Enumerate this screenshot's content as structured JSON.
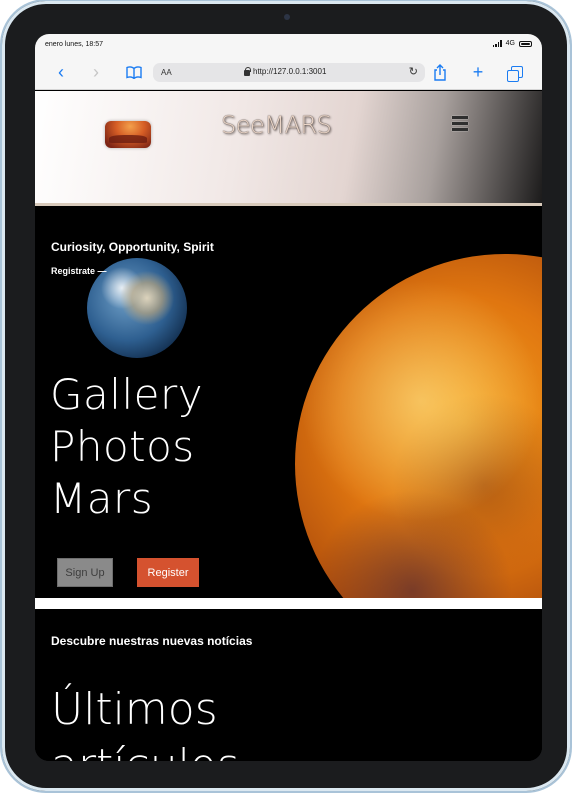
{
  "status": {
    "time": "enero lunes, 18:57",
    "network": "4G"
  },
  "browser": {
    "text_size_label": "AA",
    "url": "http://127.0.0.1:3001"
  },
  "site": {
    "brand": "SeeMARS"
  },
  "hero": {
    "tagline": "Curiosity, Opportunity, Spirit",
    "registrate": "Registrate —",
    "title_line1": "Gallery",
    "title_line2": "Photos",
    "title_line3": "Mars",
    "signup_label": "Sign Up",
    "register_label": "Register"
  },
  "news": {
    "eyebrow": "Descubre nuestras nuevas notícias",
    "title_line1": "Últimos",
    "title_line2": "artículos"
  },
  "colors": {
    "register_button": "#d5522f",
    "signup_button": "#8a8a8a",
    "safari_accent": "#1b7cf2"
  },
  "icons": [
    "back-icon",
    "forward-icon",
    "bookmarks-icon",
    "lock-icon",
    "reload-icon",
    "share-icon",
    "new-tab-icon",
    "tabs-icon",
    "hamburger-menu-icon"
  ]
}
